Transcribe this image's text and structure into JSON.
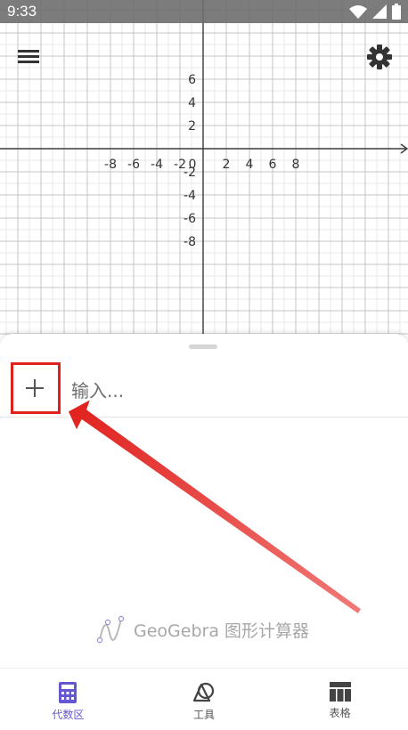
{
  "status_bar": {
    "time": "9:33"
  },
  "graph": {
    "x_ticks": [
      "-8",
      "-6",
      "-4",
      "-2",
      "0",
      "2",
      "4",
      "6",
      "8"
    ],
    "y_ticks_positive": [
      "6",
      "4",
      "2"
    ],
    "y_ticks_negative": [
      "-2",
      "-4",
      "-6",
      "-8"
    ]
  },
  "algebra": {
    "add_icon": "plus-icon",
    "input_placeholder": "输入..."
  },
  "brand": {
    "name": "GeoGebra 图形计算器"
  },
  "tabs": [
    {
      "label": "代数区",
      "icon": "calculator-icon",
      "active": true
    },
    {
      "label": "工具",
      "icon": "tools-icon",
      "active": false
    },
    {
      "label": "表格",
      "icon": "table-icon",
      "active": false
    }
  ],
  "colors": {
    "accent": "#6557d2",
    "highlight": "#e0201c"
  }
}
